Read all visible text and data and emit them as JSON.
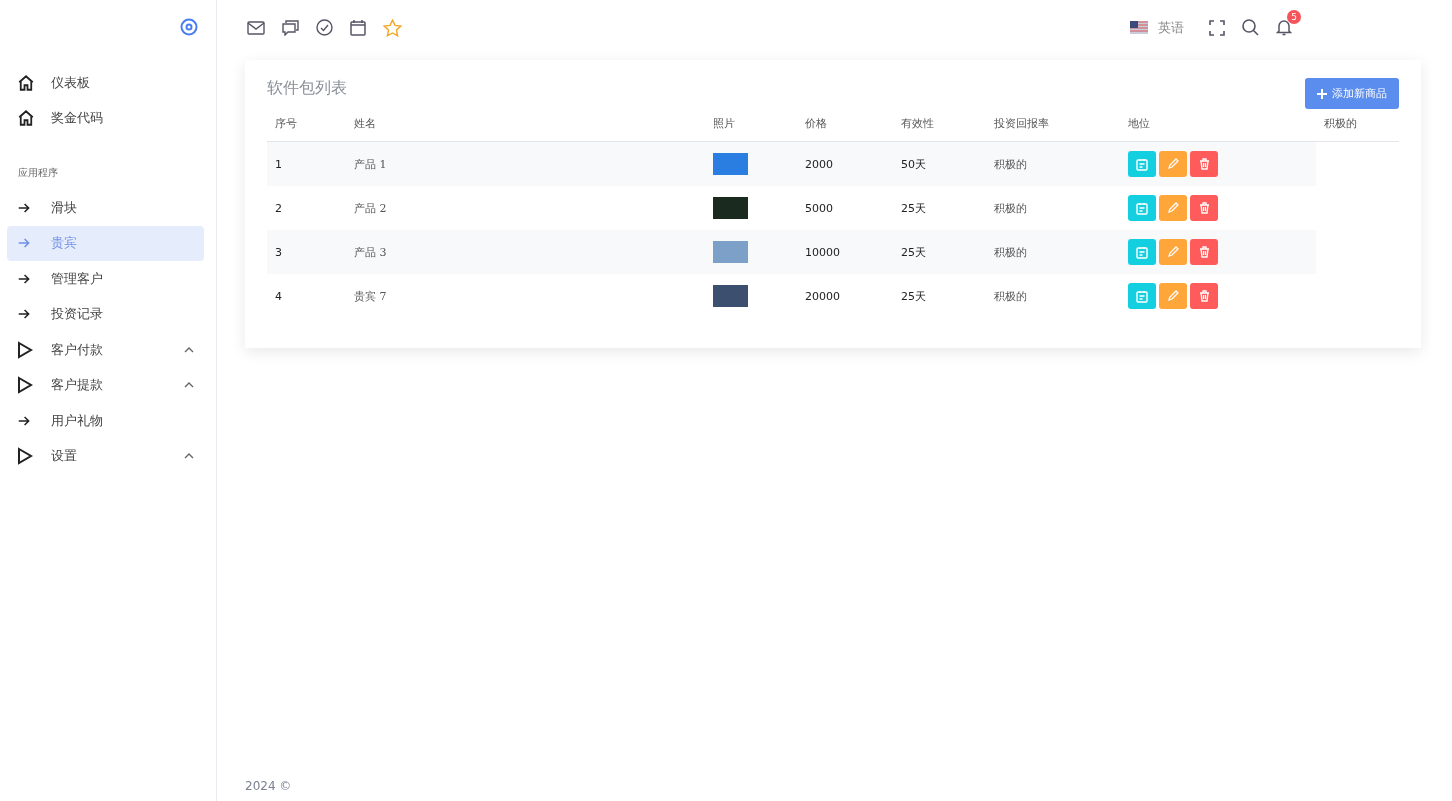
{
  "sidebar": {
    "sections": [
      {
        "items": [
          {
            "label": "仪表板",
            "kind": "top",
            "selected": false
          },
          {
            "label": "奖金代码",
            "kind": "top",
            "selected": false
          }
        ]
      },
      {
        "heading": "应用程序",
        "items": [
          {
            "label": "滑块",
            "kind": "link",
            "selected": false
          },
          {
            "label": "贵宾",
            "kind": "link",
            "selected": true
          },
          {
            "label": "管理客户",
            "kind": "link",
            "selected": false
          },
          {
            "label": "投资记录",
            "kind": "link",
            "selected": false
          },
          {
            "label": "客户付款",
            "kind": "group",
            "selected": false
          },
          {
            "label": "客户提款",
            "kind": "group",
            "selected": false
          },
          {
            "label": "用户礼物",
            "kind": "link",
            "selected": false
          },
          {
            "label": "设置",
            "kind": "group",
            "selected": false
          }
        ]
      }
    ]
  },
  "header": {
    "language": "英语",
    "notification_count": "5"
  },
  "card": {
    "title": "软件包列表",
    "add_button": "添加新商品",
    "columns": [
      "序号",
      "姓名",
      "照片",
      "价格",
      "有效性",
      "投资回报率",
      "地位",
      "积极的"
    ],
    "rows": [
      {
        "index": "1",
        "name": "产品 1",
        "price": "2000",
        "validity": "50天",
        "roi": "积极的"
      },
      {
        "index": "2",
        "name": "产品 2",
        "price": "5000",
        "validity": "25天",
        "roi": "积极的"
      },
      {
        "index": "3",
        "name": "产品 3",
        "price": "10000",
        "validity": "25天",
        "roi": "积极的"
      },
      {
        "index": "4",
        "name": "贵宾 7",
        "price": "20000",
        "validity": "25天",
        "roi": "积极的"
      }
    ]
  },
  "footer": "2024 ©"
}
